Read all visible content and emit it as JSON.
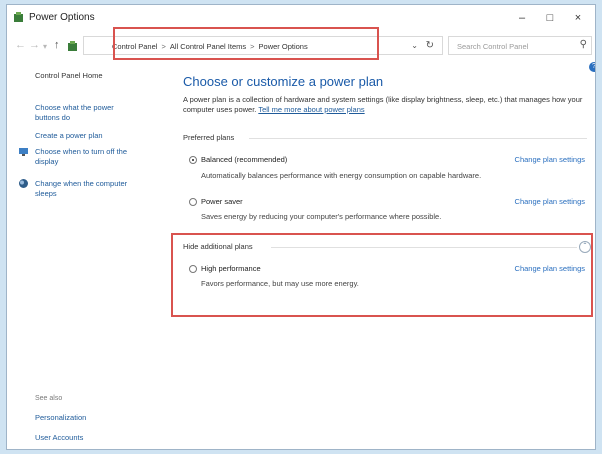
{
  "window": {
    "title": "Power Options",
    "minimize": "–",
    "maximize": "□",
    "close": "×"
  },
  "address": {
    "crumbs": [
      "Control Panel",
      "All Control Panel Items",
      "Power Options"
    ],
    "separator": ">",
    "search_placeholder": "Search Control Panel"
  },
  "sidebar": {
    "home": "Control Panel Home",
    "links": [
      "Choose what the power buttons do",
      "Create a power plan",
      "Choose when to turn off the display",
      "Change when the computer sleeps"
    ],
    "see_also_label": "See also",
    "see_also": [
      "Personalization",
      "User Accounts"
    ]
  },
  "main": {
    "heading": "Choose or customize a power plan",
    "intro": "A power plan is a collection of hardware and system settings (like display brightness, sleep, etc.) that manages how your computer uses power.",
    "learn_more": "Tell me more about power plans",
    "preferred_label": "Preferred plans",
    "hidden_label": "Hide additional plans",
    "change_label": "Change plan settings",
    "plans": [
      {
        "name": "Balanced (recommended)",
        "desc": "Automatically balances performance with energy consumption on capable hardware.",
        "selected": true
      },
      {
        "name": "Power saver",
        "desc": "Saves energy by reducing your computer's performance where possible.",
        "selected": false
      },
      {
        "name": "High performance",
        "desc": "Favors performance, but may use more energy.",
        "selected": false
      }
    ]
  },
  "colors": {
    "accent": "#1a5aa8",
    "link": "#2a6fbf",
    "highlight": "#d9534f"
  },
  "icons": {
    "app": "power-options-icon",
    "search": "search-icon",
    "help": "help-icon"
  }
}
